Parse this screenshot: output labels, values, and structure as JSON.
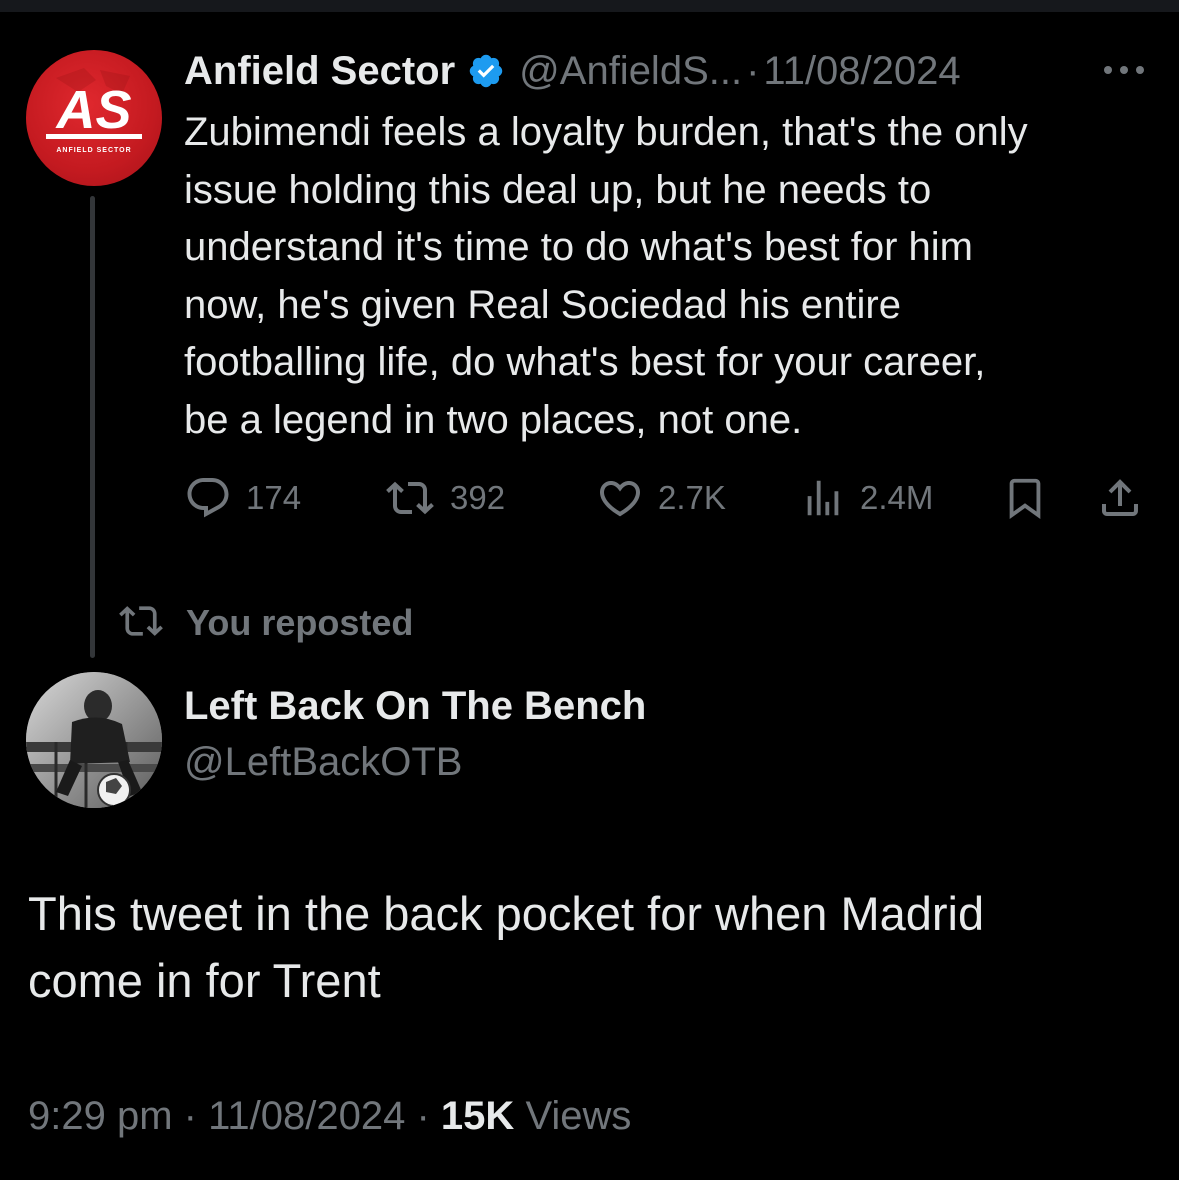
{
  "quoted_tweet": {
    "author_name": "Anfield Sector",
    "handle": "@AnfieldS...",
    "separator": "·",
    "date": "11/08/2024",
    "avatar_text": "AS",
    "avatar_subtext": "ANFIELD SECTOR",
    "text_lines": [
      "Zubimendi feels a loyalty burden, that's the only",
      "issue holding this deal up, but he needs to",
      "understand it's time to do what's best for him",
      "now, he's given Real Sociedad his entire",
      "footballing life, do what's best for your career,",
      "be a legend in two places, not one."
    ],
    "actions": {
      "replies": "174",
      "reposts": "392",
      "likes": "2.7K",
      "views": "2.4M"
    },
    "icons": [
      "verified-badge-icon",
      "more-icon",
      "reply-icon",
      "repost-icon",
      "like-icon",
      "views-icon",
      "bookmark-icon",
      "share-icon"
    ]
  },
  "repost_indicator": {
    "label": "You reposted",
    "icon": "repost-icon"
  },
  "main_tweet": {
    "author_name": "Left Back On The Bench",
    "handle": "@LeftBackOTB",
    "text_lines": [
      "This tweet in the back pocket for when Madrid",
      "come in for Trent"
    ],
    "time": "9:29 pm",
    "separator": "·",
    "date": "11/08/2024",
    "views_count": "15K",
    "views_label": "Views"
  },
  "colors": {
    "background": "#000000",
    "primary_text": "#e7e9ea",
    "secondary_text": "#71767b",
    "verified_blue": "#1d9bf0",
    "avatar_red": "#c41a20",
    "thread_line": "#333639"
  }
}
